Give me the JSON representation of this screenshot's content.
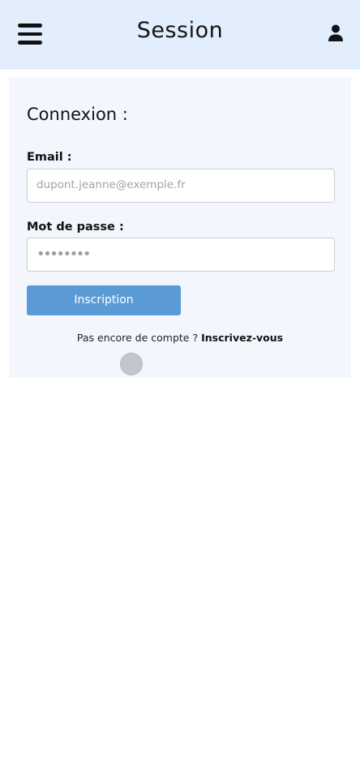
{
  "header": {
    "title": "Session",
    "menu_icon": "hamburger-menu-icon",
    "user_icon": "user-icon",
    "background_color": "#e3eefc"
  },
  "login_form": {
    "title": "Connexion :",
    "email": {
      "label": "Email :",
      "placeholder": "dupont.jeanne@exemple.fr",
      "value": ""
    },
    "password": {
      "label": "Mot de passe :",
      "value_masked": "••••••••"
    },
    "submit_label": "Inscription",
    "signup_prompt": "Pas encore de compte ?",
    "signup_link": "Inscrivez-vous"
  },
  "colors": {
    "primary_button": "#5b9bd5",
    "card_background": "#f3f7fd"
  }
}
